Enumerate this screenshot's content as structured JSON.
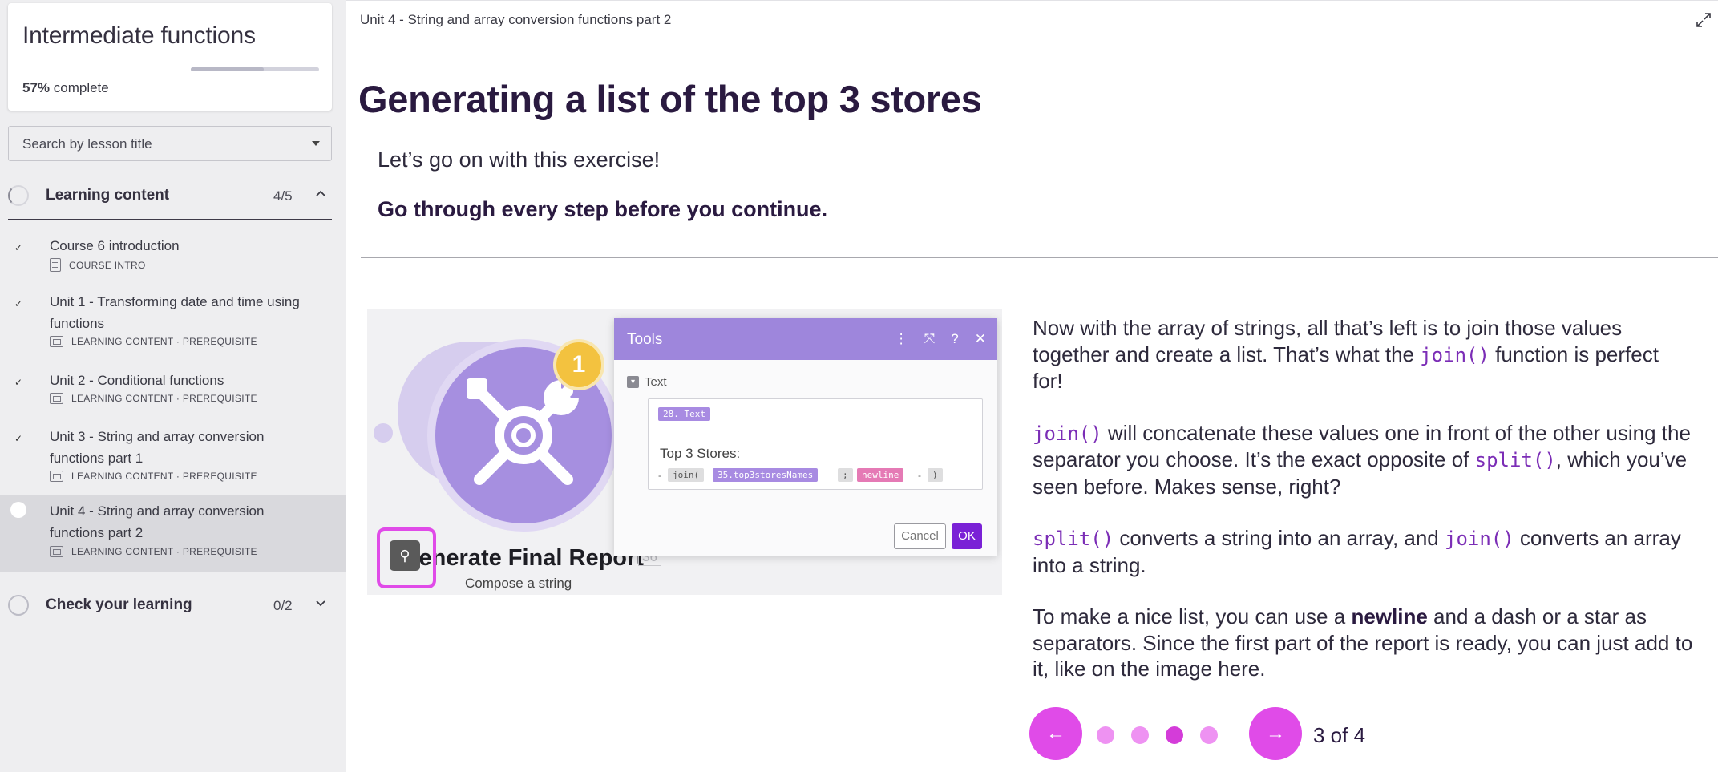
{
  "sidebar": {
    "course_title": "Intermediate functions",
    "progress_percent": "57%",
    "progress_suffix": " complete",
    "progress_fraction": 0.57,
    "search_placeholder": "Search by lesson title",
    "sections": [
      {
        "label": "Learning content",
        "count": "4/5",
        "expanded": true,
        "lessons": [
          {
            "title": "Course 6 introduction",
            "meta": "COURSE INTRO",
            "done": true
          },
          {
            "title": "Unit 1 - Transforming date and time using functions",
            "meta": "LEARNING CONTENT · PREREQUISITE",
            "done": true
          },
          {
            "title": "Unit 2 - Conditional functions",
            "meta": "LEARNING CONTENT · PREREQUISITE",
            "done": true
          },
          {
            "title": "Unit 3 - String and array conversion functions part 1",
            "meta": "LEARNING CONTENT · PREREQUISITE",
            "done": true
          },
          {
            "title": "Unit 4 - String and array conversion functions part 2",
            "meta": "LEARNING CONTENT · PREREQUISITE",
            "done": false,
            "active": true
          }
        ]
      },
      {
        "label": "Check your learning",
        "count": "0/2",
        "expanded": false
      }
    ]
  },
  "main": {
    "breadcrumb": "Unit 4 - String and array conversion functions part 2",
    "title": "Generating a list of the top 3 stores",
    "intro": "Let’s go on with this exercise!",
    "intro_bold": "Go through every step before you continue.",
    "image": {
      "badge": "1",
      "module_title": "Generate Final Report",
      "module_number": "36",
      "module_subtitle": "Compose a string",
      "dialog": {
        "title": "Tools",
        "field_label": "Text",
        "token_text": "28. Text",
        "line": "Top 3 Stores:",
        "token_join": "join(",
        "token_names": "35.top3storesNames",
        "token_sep": ";",
        "token_newline": "newline",
        "token_close": ")",
        "dash_1": "-",
        "dash_2": "-",
        "cancel_label": "Cancel",
        "ok_label": "OK"
      }
    },
    "paragraphs": {
      "p1_a": "Now with the array of strings, all that’s left is to join those values together and create a list. That’s what the ",
      "p1_code": "join()",
      "p1_b": "  function is perfect for!",
      "p2_code": "join()",
      "p2_a": "  will concatenate these values one in front of the other using the separator you choose. It’s the exact opposite of ",
      "p2_code2": "split()",
      "p2_b": ", which you’ve seen before. Makes sense, right?",
      "p3_code": "split()",
      "p3_a": "  converts a string into an array, and ",
      "p3_code2": "join()",
      "p3_b": "  converts an array into a string.",
      "p4_a": "To make a nice list, you can use a ",
      "p4_bold": "newline",
      "p4_b": " and a dash or a star as separators. Since the first part of the report is ready, you can just add to it, like on the image here."
    },
    "pager": {
      "label": "3 of 4",
      "current": 3,
      "total": 4,
      "prev_icon": "arrow-left-icon",
      "next_icon": "arrow-right-icon"
    }
  },
  "colors": {
    "accent": "#e04be8",
    "title": "#2a1a40",
    "code": "#7b2db6",
    "ok_button": "#7a21d6"
  }
}
